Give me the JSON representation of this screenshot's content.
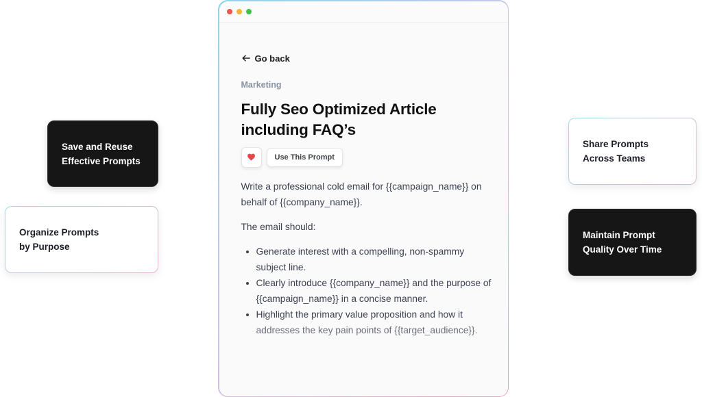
{
  "window": {
    "go_back_label": "Go back",
    "category": "Marketing",
    "title": "Fully Seo Optimized Article including FAQ’s",
    "use_prompt_label": "Use This Prompt",
    "intro": "Write a professional cold email for {{campaign_name}} on behalf of {{company_name}}.",
    "subheading": "The email should:",
    "bullets": [
      "Generate interest with a compelling, non-spammy subject line.",
      "Clearly introduce {{company_name}} and the purpose of {{campaign_name}} in a concise manner.",
      "Highlight the primary value proposition and how it addresses the key pain points of {{target_audience}}."
    ]
  },
  "cards": {
    "save": "Save and Reuse\nEffective Prompts",
    "organize": "Organize Prompts\nby Purpose",
    "share": "Share Prompts\nAcross Teams",
    "maintain": "Maintain Prompt\nQuality Over Time"
  },
  "colors": {
    "heart": "#e8464f",
    "dark_card": "#161616",
    "border_start": "#8fd6ea",
    "border_end": "#f19ab8"
  },
  "icons": {
    "back": "arrow-left-icon",
    "favorite": "heart-icon"
  }
}
